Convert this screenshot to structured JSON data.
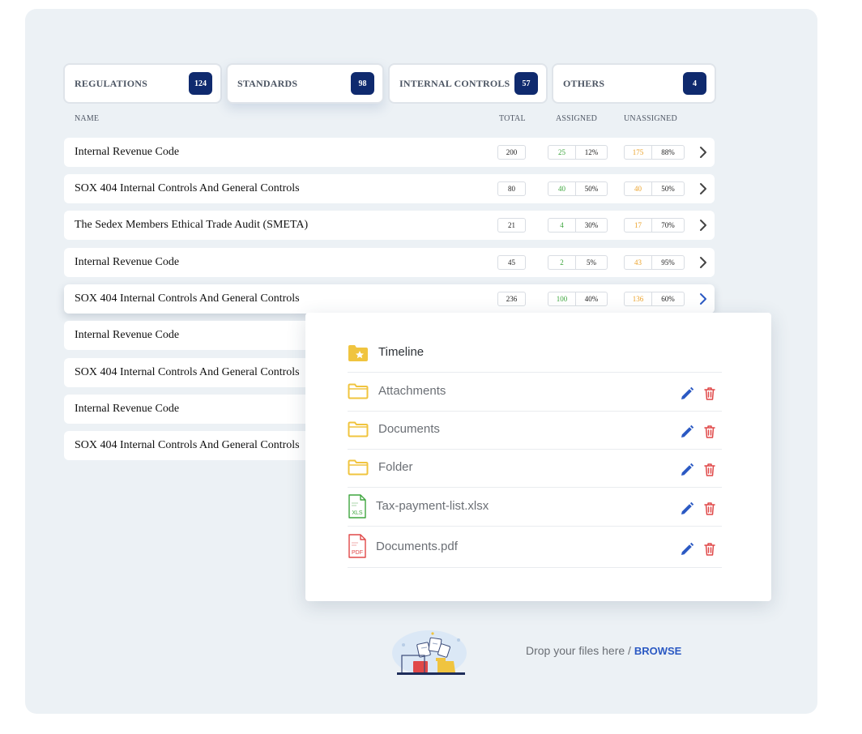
{
  "tabs": [
    {
      "label": "REGULATIONS",
      "count": "124"
    },
    {
      "label": "STANDARDS",
      "count": "98"
    },
    {
      "label": "INTERNAL CONTROLS",
      "count": "57"
    },
    {
      "label": "OTHERS",
      "count": "4"
    }
  ],
  "columns": {
    "name": "NAME",
    "total": "TOTAL",
    "assigned": "ASSIGNED",
    "unassigned": "UNASSIGNED"
  },
  "rows": [
    {
      "name": "Internal Revenue Code",
      "total": "200",
      "assigned": "25",
      "assigned_pct": "12%",
      "unassigned": "175",
      "unassigned_pct": "88%"
    },
    {
      "name": "SOX 404 Internal Controls And General Controls",
      "total": "80",
      "assigned": "40",
      "assigned_pct": "50%",
      "unassigned": "40",
      "unassigned_pct": "50%"
    },
    {
      "name": "The Sedex Members Ethical Trade Audit (SMETA)",
      "total": "21",
      "assigned": "4",
      "assigned_pct": "30%",
      "unassigned": "17",
      "unassigned_pct": "70%"
    },
    {
      "name": "Internal Revenue Code",
      "total": "45",
      "assigned": "2",
      "assigned_pct": "5%",
      "unassigned": "43",
      "unassigned_pct": "95%"
    },
    {
      "name": "SOX 404 Internal Controls And General Controls",
      "total": "236",
      "assigned": "100",
      "assigned_pct": "40%",
      "unassigned": "136",
      "unassigned_pct": "60%"
    },
    {
      "name": "Internal Revenue Code"
    },
    {
      "name": "SOX 404 Internal Controls And General Controls"
    },
    {
      "name": "Internal Revenue Code"
    },
    {
      "name": "SOX 404 Internal Controls And General Controls"
    }
  ],
  "popup": {
    "items": [
      {
        "name": "Timeline",
        "icon": "starred-folder-icon"
      },
      {
        "name": "Attachments",
        "icon": "folder-icon"
      },
      {
        "name": "Documents",
        "icon": "folder-icon"
      },
      {
        "name": "Folder",
        "icon": "folder-icon"
      },
      {
        "name": "Tax-payment-list.xlsx",
        "icon": "xls-file-icon",
        "badge": "XLS"
      },
      {
        "name": "Documents.pdf",
        "icon": "pdf-file-icon",
        "badge": "PDF"
      }
    ]
  },
  "drop": {
    "text": "Drop your files here / ",
    "browse": "BROWSE"
  },
  "colors": {
    "accent_dark": "#0f2a6e",
    "assigned_green": "#3ea63e",
    "unassigned_orange": "#eba22a",
    "edit_blue": "#2b59c3",
    "delete_red": "#e04848",
    "folder_yellow": "#f0c43f",
    "xls_green": "#3ea63e",
    "pdf_red": "#e04848"
  }
}
